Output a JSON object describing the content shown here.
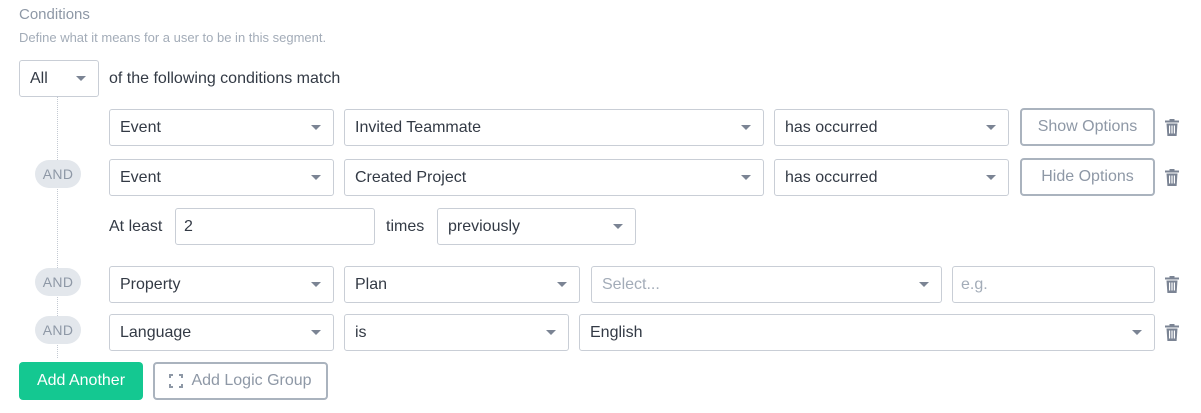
{
  "section": {
    "title": "Conditions",
    "description": "Define what it means for a user to be in this segment."
  },
  "match": {
    "mode": "All",
    "suffix": "of the following conditions match"
  },
  "conditions": [
    {
      "type": "Event",
      "value": "Invited Teammate",
      "operator": "has occurred",
      "options_button": "Show Options"
    },
    {
      "connector": "AND",
      "type": "Event",
      "value": "Created Project",
      "operator": "has occurred",
      "options_button": "Hide Options",
      "options": {
        "prefix": "At least",
        "count": "2",
        "unit": "times",
        "timeframe": "previously"
      }
    },
    {
      "connector": "AND",
      "type": "Property",
      "value": "Plan",
      "operator_placeholder": "Select...",
      "value_placeholder": "e.g."
    },
    {
      "connector": "AND",
      "type": "Language",
      "operator": "is",
      "value": "English"
    }
  ],
  "actions": {
    "add_another": "Add Another",
    "add_logic_group": "Add Logic Group"
  },
  "colors": {
    "primary": "#14c891",
    "muted_text": "#8e98a6",
    "border": "#c9ced6"
  }
}
